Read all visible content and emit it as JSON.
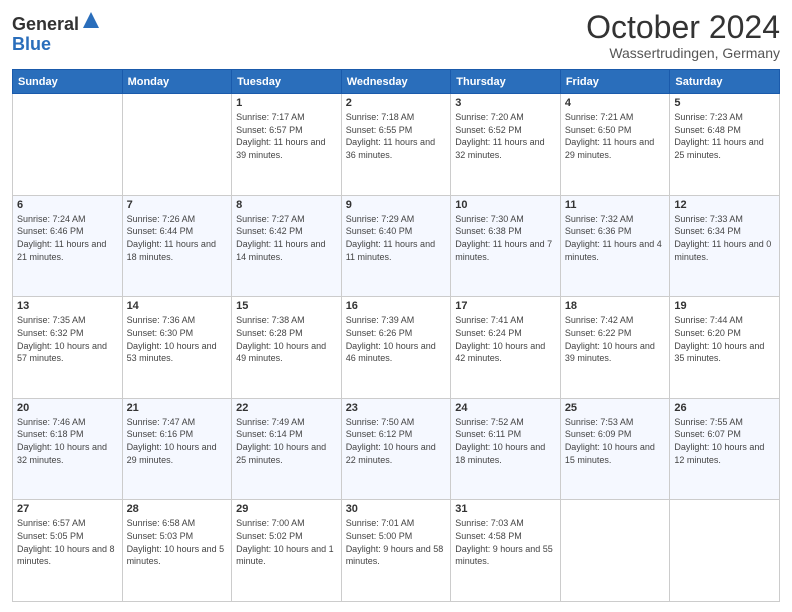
{
  "header": {
    "logo_general": "General",
    "logo_blue": "Blue",
    "month": "October 2024",
    "location": "Wassertrudingen, Germany"
  },
  "days_of_week": [
    "Sunday",
    "Monday",
    "Tuesday",
    "Wednesday",
    "Thursday",
    "Friday",
    "Saturday"
  ],
  "weeks": [
    [
      {
        "day": "",
        "info": ""
      },
      {
        "day": "",
        "info": ""
      },
      {
        "day": "1",
        "info": "Sunrise: 7:17 AM\nSunset: 6:57 PM\nDaylight: 11 hours and 39 minutes."
      },
      {
        "day": "2",
        "info": "Sunrise: 7:18 AM\nSunset: 6:55 PM\nDaylight: 11 hours and 36 minutes."
      },
      {
        "day": "3",
        "info": "Sunrise: 7:20 AM\nSunset: 6:52 PM\nDaylight: 11 hours and 32 minutes."
      },
      {
        "day": "4",
        "info": "Sunrise: 7:21 AM\nSunset: 6:50 PM\nDaylight: 11 hours and 29 minutes."
      },
      {
        "day": "5",
        "info": "Sunrise: 7:23 AM\nSunset: 6:48 PM\nDaylight: 11 hours and 25 minutes."
      }
    ],
    [
      {
        "day": "6",
        "info": "Sunrise: 7:24 AM\nSunset: 6:46 PM\nDaylight: 11 hours and 21 minutes."
      },
      {
        "day": "7",
        "info": "Sunrise: 7:26 AM\nSunset: 6:44 PM\nDaylight: 11 hours and 18 minutes."
      },
      {
        "day": "8",
        "info": "Sunrise: 7:27 AM\nSunset: 6:42 PM\nDaylight: 11 hours and 14 minutes."
      },
      {
        "day": "9",
        "info": "Sunrise: 7:29 AM\nSunset: 6:40 PM\nDaylight: 11 hours and 11 minutes."
      },
      {
        "day": "10",
        "info": "Sunrise: 7:30 AM\nSunset: 6:38 PM\nDaylight: 11 hours and 7 minutes."
      },
      {
        "day": "11",
        "info": "Sunrise: 7:32 AM\nSunset: 6:36 PM\nDaylight: 11 hours and 4 minutes."
      },
      {
        "day": "12",
        "info": "Sunrise: 7:33 AM\nSunset: 6:34 PM\nDaylight: 11 hours and 0 minutes."
      }
    ],
    [
      {
        "day": "13",
        "info": "Sunrise: 7:35 AM\nSunset: 6:32 PM\nDaylight: 10 hours and 57 minutes."
      },
      {
        "day": "14",
        "info": "Sunrise: 7:36 AM\nSunset: 6:30 PM\nDaylight: 10 hours and 53 minutes."
      },
      {
        "day": "15",
        "info": "Sunrise: 7:38 AM\nSunset: 6:28 PM\nDaylight: 10 hours and 49 minutes."
      },
      {
        "day": "16",
        "info": "Sunrise: 7:39 AM\nSunset: 6:26 PM\nDaylight: 10 hours and 46 minutes."
      },
      {
        "day": "17",
        "info": "Sunrise: 7:41 AM\nSunset: 6:24 PM\nDaylight: 10 hours and 42 minutes."
      },
      {
        "day": "18",
        "info": "Sunrise: 7:42 AM\nSunset: 6:22 PM\nDaylight: 10 hours and 39 minutes."
      },
      {
        "day": "19",
        "info": "Sunrise: 7:44 AM\nSunset: 6:20 PM\nDaylight: 10 hours and 35 minutes."
      }
    ],
    [
      {
        "day": "20",
        "info": "Sunrise: 7:46 AM\nSunset: 6:18 PM\nDaylight: 10 hours and 32 minutes."
      },
      {
        "day": "21",
        "info": "Sunrise: 7:47 AM\nSunset: 6:16 PM\nDaylight: 10 hours and 29 minutes."
      },
      {
        "day": "22",
        "info": "Sunrise: 7:49 AM\nSunset: 6:14 PM\nDaylight: 10 hours and 25 minutes."
      },
      {
        "day": "23",
        "info": "Sunrise: 7:50 AM\nSunset: 6:12 PM\nDaylight: 10 hours and 22 minutes."
      },
      {
        "day": "24",
        "info": "Sunrise: 7:52 AM\nSunset: 6:11 PM\nDaylight: 10 hours and 18 minutes."
      },
      {
        "day": "25",
        "info": "Sunrise: 7:53 AM\nSunset: 6:09 PM\nDaylight: 10 hours and 15 minutes."
      },
      {
        "day": "26",
        "info": "Sunrise: 7:55 AM\nSunset: 6:07 PM\nDaylight: 10 hours and 12 minutes."
      }
    ],
    [
      {
        "day": "27",
        "info": "Sunrise: 6:57 AM\nSunset: 5:05 PM\nDaylight: 10 hours and 8 minutes."
      },
      {
        "day": "28",
        "info": "Sunrise: 6:58 AM\nSunset: 5:03 PM\nDaylight: 10 hours and 5 minutes."
      },
      {
        "day": "29",
        "info": "Sunrise: 7:00 AM\nSunset: 5:02 PM\nDaylight: 10 hours and 1 minute."
      },
      {
        "day": "30",
        "info": "Sunrise: 7:01 AM\nSunset: 5:00 PM\nDaylight: 9 hours and 58 minutes."
      },
      {
        "day": "31",
        "info": "Sunrise: 7:03 AM\nSunset: 4:58 PM\nDaylight: 9 hours and 55 minutes."
      },
      {
        "day": "",
        "info": ""
      },
      {
        "day": "",
        "info": ""
      }
    ]
  ]
}
